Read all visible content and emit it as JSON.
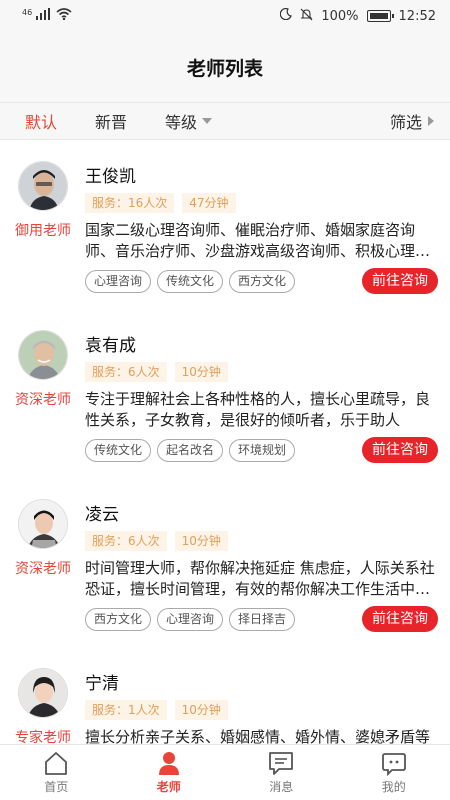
{
  "status_bar": {
    "signal": "46",
    "battery": "100%",
    "time": "12:52",
    "icons": [
      "signal-icon",
      "wifi-icon",
      "moon-icon",
      "mute-icon",
      "battery-icon"
    ]
  },
  "header": {
    "title": "老师列表"
  },
  "filters": {
    "items": [
      {
        "label": "默认",
        "active": true
      },
      {
        "label": "新晋",
        "active": false
      },
      {
        "label": "等级",
        "active": false
      }
    ],
    "filter_label": "筛选"
  },
  "teachers": [
    {
      "name": "王俊凯",
      "grade": "御用老师",
      "service": "服务：16人次",
      "duration": "47分钟",
      "description": "国家二级心理咨询师、催眠治疗师、婚姻家庭咨询师、音乐治疗师、沙盘游戏高级咨询师、积极心理学指导师",
      "tags": [
        "心理咨询",
        "传统文化",
        "西方文化"
      ],
      "button": "前往咨询"
    },
    {
      "name": "袁有成",
      "grade": "资深老师",
      "service": "服务：6人次",
      "duration": "10分钟",
      "description": "专注于理解社会上各种性格的人，擅长心里疏导，良性关系，子女教育，是很好的倾听者，乐于助人",
      "tags": [
        "传统文化",
        "起名改名",
        "环境规划"
      ],
      "button": "前往咨询"
    },
    {
      "name": "凌云",
      "grade": "资深老师",
      "service": "服务：6人次",
      "duration": "10分钟",
      "description": "时间管理大师，帮你解决拖延症 焦虑症，人际关系社恐证，擅长时间管理，有效的帮你解决工作生活中的难题",
      "tags": [
        "西方文化",
        "心理咨询",
        "择日择吉"
      ],
      "button": "前往咨询"
    },
    {
      "name": "宁清",
      "grade": "专家老师",
      "service": "服务：1人次",
      "duration": "10分钟",
      "description": "擅长分析亲子关系、婚姻感情、婚外情、婆媳矛盾等问题",
      "tags": [],
      "button": ""
    }
  ],
  "bottom_nav": [
    {
      "label": "首页",
      "icon": "home-icon",
      "active": false
    },
    {
      "label": "老师",
      "icon": "teacher-icon",
      "active": true
    },
    {
      "label": "消息",
      "icon": "message-icon",
      "active": false
    },
    {
      "label": "我的",
      "icon": "profile-icon",
      "active": false
    }
  ],
  "colors": {
    "accent": "#e8443a",
    "button_red": "#e8232a",
    "stat_bg": "#fdf3e6",
    "stat_text": "#e0a05a"
  }
}
